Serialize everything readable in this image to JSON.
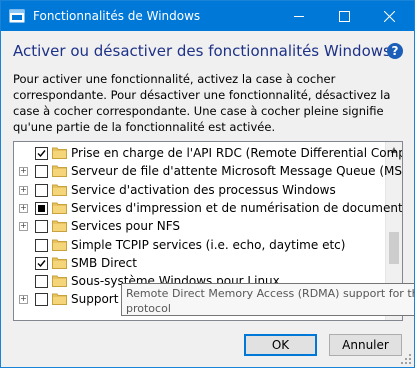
{
  "window": {
    "title": "Fonctionnalités de Windows",
    "heading": "Activer ou désactiver des fonctionnalités Windows",
    "help_symbol": "?",
    "description": "Pour activer une fonctionnalité, activez la case à cocher correspondante. Pour désactiver une fonctionnalité, désactivez la case à cocher correspondante. Une case à cocher pleine signifie qu'une partie de la fonctionnalité est activée."
  },
  "features": [
    {
      "label": "Prise en charge de l'API RDC (Remote Differential Compressi",
      "state": "checked",
      "expandable": false
    },
    {
      "label": "Serveur de file d'attente Microsoft Message Queue (MSMQ)",
      "state": "unchecked",
      "expandable": true
    },
    {
      "label": "Service d'activation des processus Windows",
      "state": "unchecked",
      "expandable": true
    },
    {
      "label": "Services d'impression et de numérisation de document",
      "state": "partial",
      "expandable": true
    },
    {
      "label": "Services pour NFS",
      "state": "unchecked",
      "expandable": true
    },
    {
      "label": "Simple TCPIP services (i.e. echo, daytime etc)",
      "state": "unchecked",
      "expandable": false
    },
    {
      "label": "SMB Direct",
      "state": "checked",
      "expandable": false
    },
    {
      "label": "Sous-système Windows pour Linux",
      "state": "unchecked",
      "expandable": false
    },
    {
      "label": "Support d",
      "state": "unchecked",
      "expandable": true
    }
  ],
  "tooltip": {
    "line1": "Remote Direct Memory Access (RDMA) support for the",
    "line2": "protocol"
  },
  "buttons": {
    "ok": "OK",
    "cancel": "Annuler"
  },
  "colors": {
    "titlebar": "#0078d7",
    "heading": "#1e3287",
    "folder": "#e8c260"
  },
  "icons": {
    "expand": "plus-expander-icon",
    "folder": "folder-icon",
    "help": "help-icon"
  }
}
